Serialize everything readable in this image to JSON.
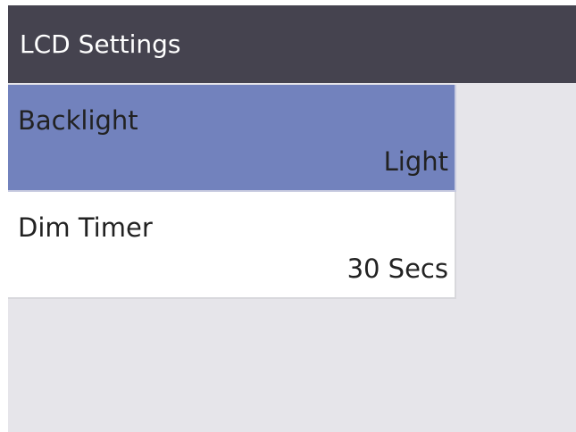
{
  "header": {
    "title": "LCD Settings"
  },
  "menu": {
    "items": [
      {
        "label": "Backlight",
        "value": "Light",
        "selected": true
      },
      {
        "label": "Dim Timer",
        "value": "30 Secs",
        "selected": false
      }
    ]
  },
  "colors": {
    "titlebar": "#45434f",
    "selected_item": "#7282bd",
    "background": "#e6e5ea",
    "item": "#ffffff"
  }
}
